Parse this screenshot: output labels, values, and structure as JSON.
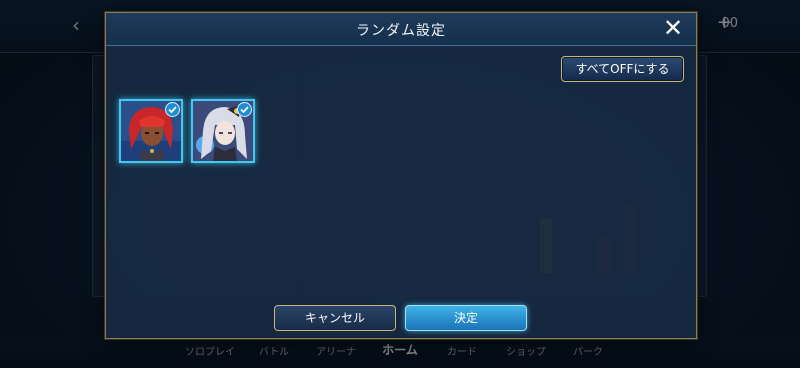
{
  "modal": {
    "title": "ランダム設定",
    "all_off_label": "すべてOFFにする",
    "cancel_label": "キャンセル",
    "confirm_label": "決定",
    "characters": [
      {
        "name": "red-haired-character",
        "selected": true
      },
      {
        "name": "white-haired-character",
        "selected": true
      }
    ]
  },
  "background": {
    "currency": "00",
    "nav": [
      "ソロプレイ",
      "バトル",
      "アリーナ",
      "ホーム",
      "カード",
      "ショップ",
      "パーク"
    ],
    "nav_active": "ホーム"
  },
  "colors": {
    "accent_blue": "#41c8f0",
    "gold_border": "#c9b47a",
    "confirm_blue": "#1a73b8"
  }
}
